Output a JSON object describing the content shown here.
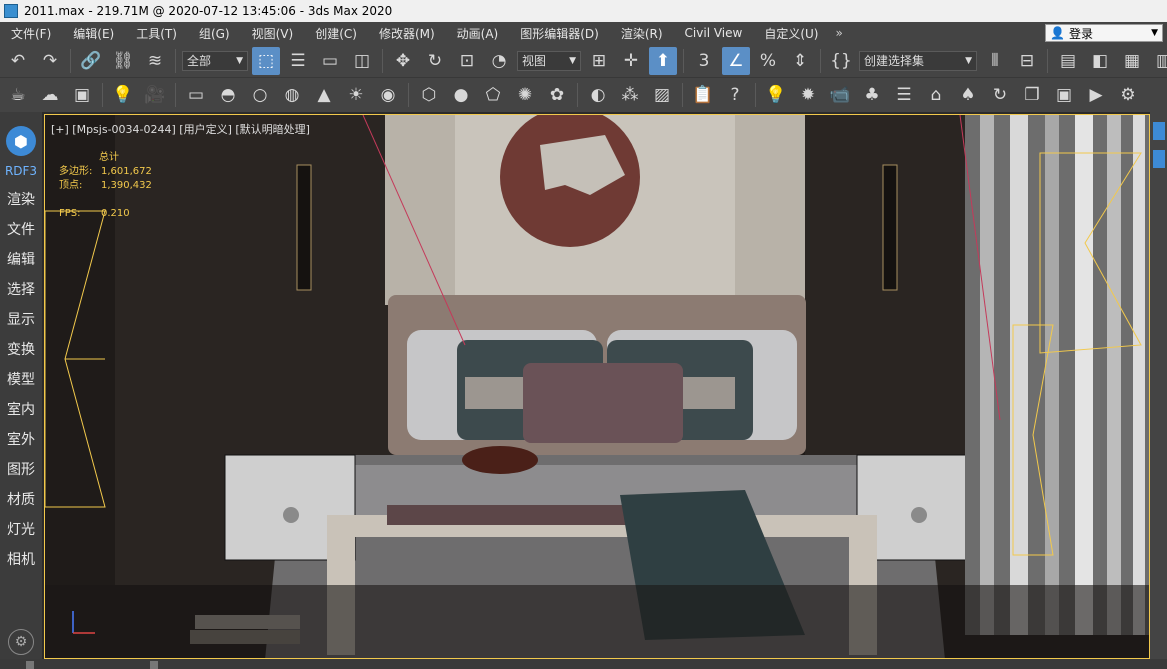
{
  "titlebar": {
    "title": "2011.max - 219.71M @ 2020-07-12 13:45:06 - 3ds Max 2020"
  },
  "menu": {
    "items": [
      "文件(F)",
      "编辑(E)",
      "工具(T)",
      "组(G)",
      "视图(V)",
      "创建(C)",
      "修改器(M)",
      "动画(A)",
      "图形编辑器(D)",
      "渲染(R)",
      "Civil View",
      "自定义(U)"
    ],
    "overflow": "»",
    "login": "登录"
  },
  "toolbar": {
    "filter_select": "全部",
    "ref_coord": "视图",
    "selection_set": "创建选择集"
  },
  "leftbar": {
    "badge": "RDF3",
    "items": [
      "渲染",
      "文件",
      "编辑",
      "选择",
      "显示",
      "变换",
      "模型",
      "室内",
      "室外",
      "图形",
      "材质",
      "灯光",
      "相机"
    ]
  },
  "viewport": {
    "label": "[+] [Mpsjs-0034-0244] [用户定义] [默认明暗处理]",
    "stats": {
      "header": "总计",
      "poly_label": "多边形:",
      "poly_value": "1,601,672",
      "vert_label": "顶点:",
      "vert_value": "1,390,432",
      "fps_label": "FPS:",
      "fps_value": "0.210"
    }
  },
  "colors": {
    "accent": "#5b8fc6",
    "selection": "#f2c94c",
    "viewport_bg": "#1e1b1a"
  }
}
